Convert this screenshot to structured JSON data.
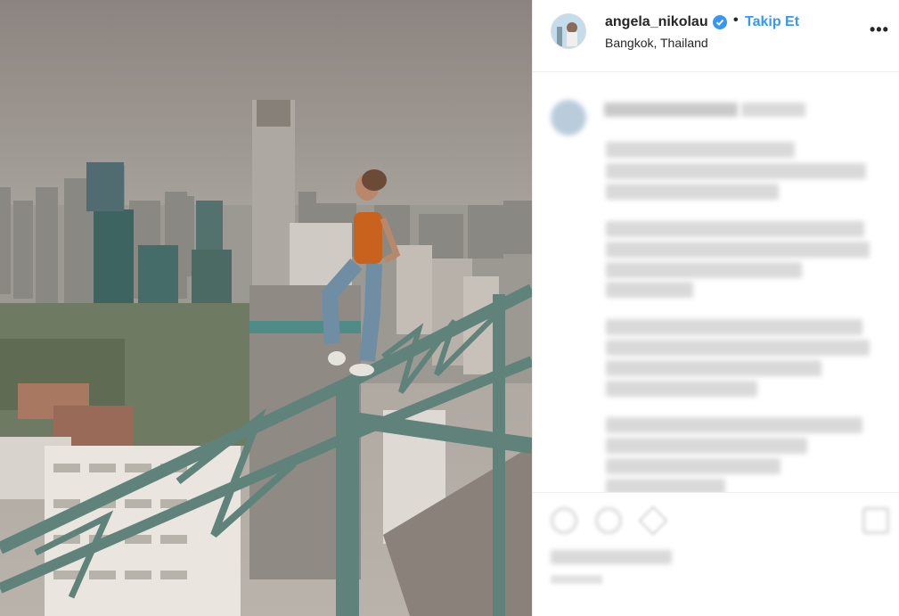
{
  "post": {
    "username": "angela_nikolau",
    "follow_label": "Takip Et",
    "separator": "•",
    "location": "Bangkok, Thailand",
    "more_label": "•••"
  },
  "colors": {
    "follow": "#3897f0",
    "verified": "#3897f0",
    "text": "#262626",
    "railing": "#6d8f86"
  },
  "icons": {
    "verified": "verified-badge-icon",
    "more": "more-options-icon",
    "like": "heart-icon",
    "comment": "comment-icon",
    "share": "share-icon",
    "save": "bookmark-icon"
  }
}
